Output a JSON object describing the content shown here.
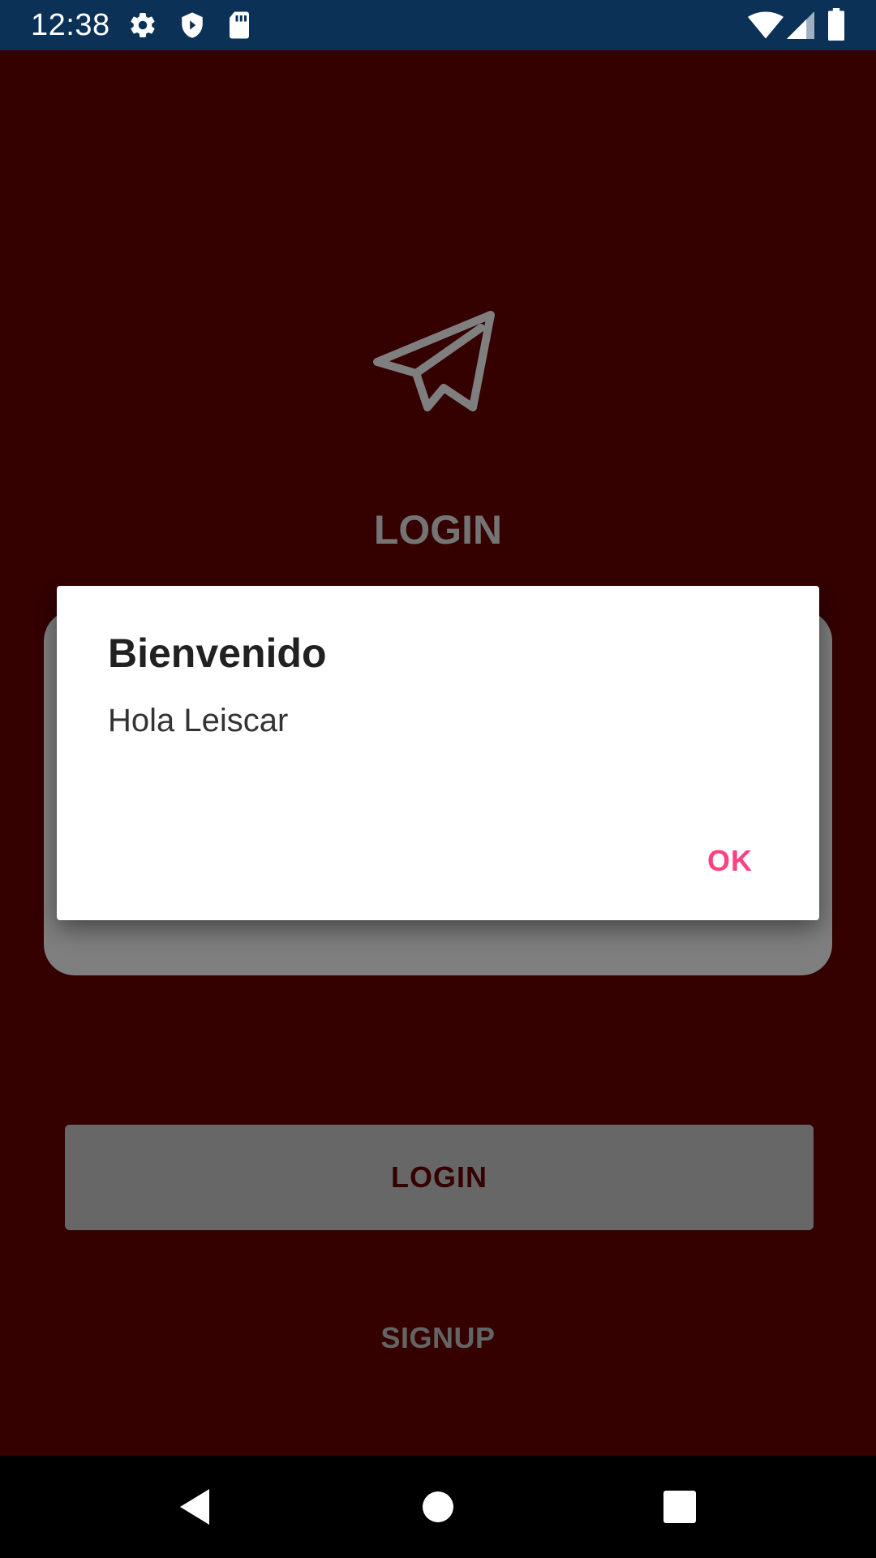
{
  "status_bar": {
    "time": "12:38",
    "icons": [
      "gear-icon",
      "shield-icon",
      "sdcard-icon",
      "wifi-icon",
      "signal-icon",
      "battery-icon"
    ]
  },
  "login_screen": {
    "logo_icon": "paper-plane-icon",
    "title": "LOGIN",
    "login_button_label": "LOGIN",
    "signup_label": "SIGNUP"
  },
  "dialog": {
    "title": "Bienvenido",
    "message": "Hola Leiscar",
    "ok_label": "OK"
  },
  "nav_bar": {
    "icons": [
      "back-icon",
      "home-icon",
      "recents-icon"
    ]
  },
  "colors": {
    "background": "#6a0000",
    "status_bar": "#0b3157",
    "accent": "#ff4081",
    "button": "#cfcfcf"
  }
}
